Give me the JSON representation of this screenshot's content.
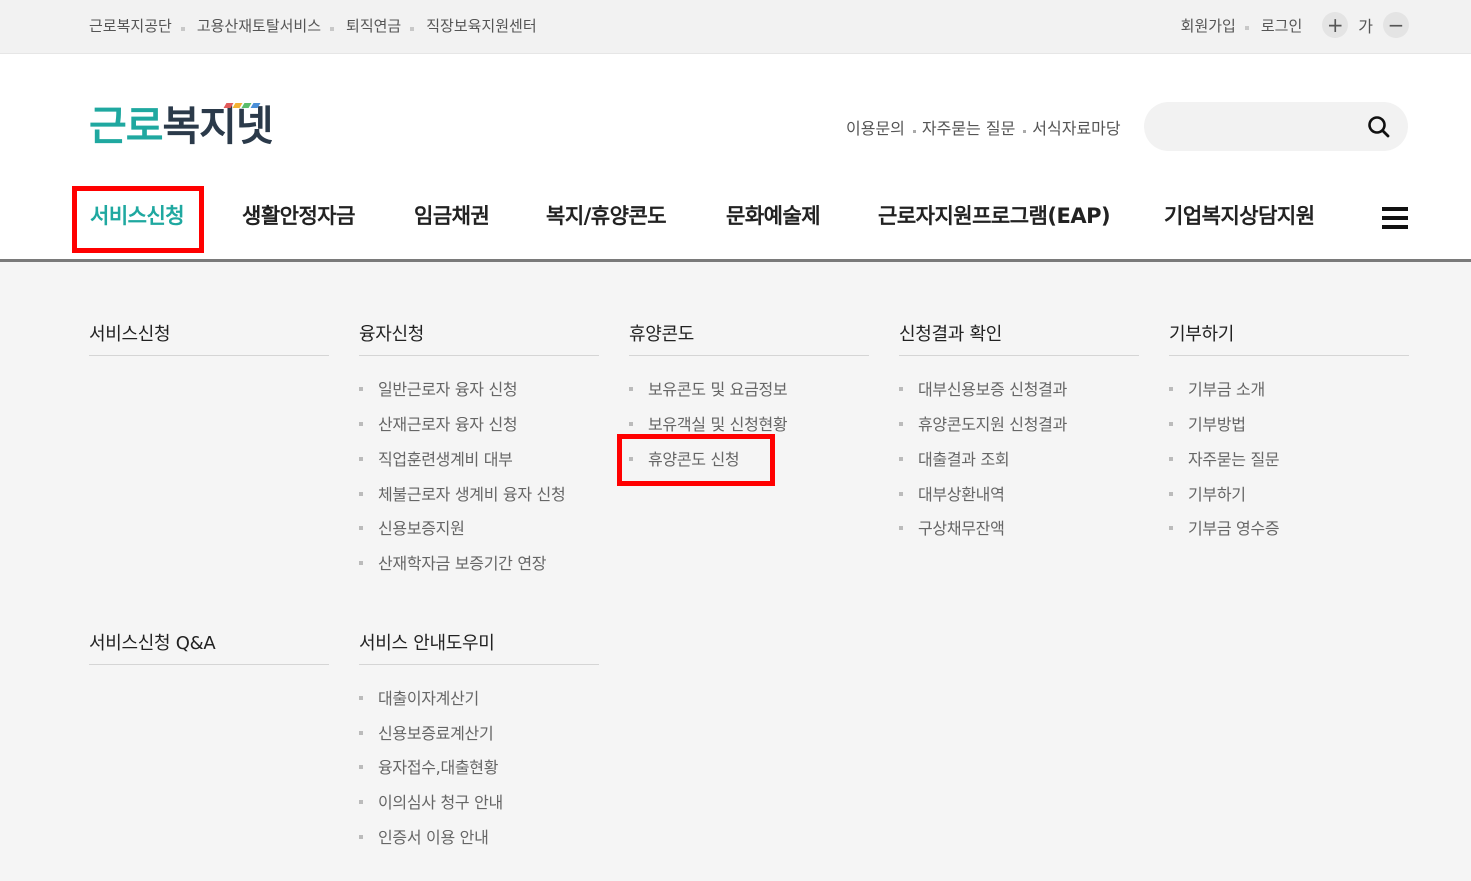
{
  "topbar": {
    "links": [
      "근로복지공단",
      "고용산재토탈서비스",
      "퇴직연금",
      "직장보육지원센터"
    ],
    "join": "회원가입",
    "login": "로그인",
    "font_plus": "+",
    "font_label": "가",
    "font_minus": "−"
  },
  "header": {
    "logo_part1": "근로",
    "logo_part2": "복지넷",
    "logo_colors": [
      "#e05a5a",
      "#f2b233",
      "#5bbd6a",
      "#4a8fd8",
      "#9b6fd0"
    ],
    "links": [
      "이용문의",
      "자주묻는 질문",
      "서식자료마당"
    ],
    "search_placeholder": "",
    "search_icon": "search-icon"
  },
  "gnb": {
    "items": [
      "서비스신청",
      "생활안정자금",
      "임금채권",
      "복지/휴양콘도",
      "문화예술제",
      "근로자지원프로그램(EAP)",
      "기업복지상담지원"
    ],
    "active_index": 0,
    "accent_color": "#1fa8a0",
    "menu_icon": "hamburger-icon"
  },
  "mega": {
    "columns": [
      {
        "title": "서비스신청",
        "items": []
      },
      {
        "title": "융자신청",
        "items": [
          "일반근로자 융자 신청",
          "산재근로자 융자 신청",
          "직업훈련생계비 대부",
          "체불근로자 생계비 융자 신청",
          "신용보증지원",
          "산재학자금 보증기간 연장"
        ]
      },
      {
        "title": "휴양콘도",
        "items": [
          "보유콘도 및 요금정보",
          "보유객실 및 신청현황",
          "휴양콘도 신청"
        ]
      },
      {
        "title": "신청결과 확인",
        "items": [
          "대부신용보증 신청결과",
          "휴양콘도지원 신청결과",
          "대출결과 조회",
          "대부상환내역",
          "구상채무잔액"
        ]
      },
      {
        "title": "기부하기",
        "items": [
          "기부금 소개",
          "기부방법",
          "자주묻는 질문",
          "기부하기",
          "기부금 영수증"
        ]
      },
      {
        "title": "서비스신청 Q&A",
        "items": []
      },
      {
        "title": "서비스 안내도우미",
        "items": [
          "대출이자계산기",
          "신용보증료계산기",
          "융자접수,대출현황",
          "이의심사 청구 안내",
          "인증서 이용 안내"
        ]
      }
    ]
  },
  "highlight_color": "#ff0000"
}
